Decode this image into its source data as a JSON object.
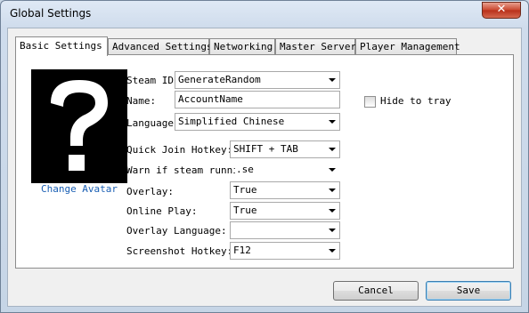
{
  "window": {
    "title": "Global Settings",
    "close_glyph": "✕",
    "close_icon": "close-icon"
  },
  "tabs": [
    {
      "label": "Basic Settings",
      "active": true
    },
    {
      "label": "Advanced Settings",
      "active": false
    },
    {
      "label": "Networking",
      "active": false
    },
    {
      "label": "Master Server",
      "active": false
    },
    {
      "label": "Player Management",
      "active": false
    }
  ],
  "avatar": {
    "icon": "question-mark-icon",
    "change_label": "Change Avatar"
  },
  "form": {
    "steam_id": {
      "label": "Steam ID:",
      "value": "GenerateRandom"
    },
    "name": {
      "label": "Name:",
      "value": "AccountName"
    },
    "language": {
      "label": "Language:",
      "value": "Simplified Chinese"
    },
    "quick_join": {
      "label": "Quick Join Hotkey:",
      "value": "SHIFT + TAB"
    },
    "warn_steam": {
      "label": "Warn if steam running:",
      "value": ".se"
    },
    "overlay": {
      "label": "Overlay:",
      "value": "True"
    },
    "online_play": {
      "label": "Online Play:",
      "value": "True"
    },
    "overlay_language": {
      "label": "Overlay Language:",
      "value": ""
    },
    "screenshot_hotkey": {
      "label": "Screenshot Hotkey:",
      "value": "F12"
    }
  },
  "hide_to_tray": {
    "label": "Hide to tray",
    "checked": false
  },
  "buttons": {
    "cancel": "Cancel",
    "save": "Save"
  },
  "colors": {
    "title_bg": "#cfdcec",
    "close": "#c9452c",
    "link": "#1a5fb4",
    "panel": "#ffffff"
  }
}
